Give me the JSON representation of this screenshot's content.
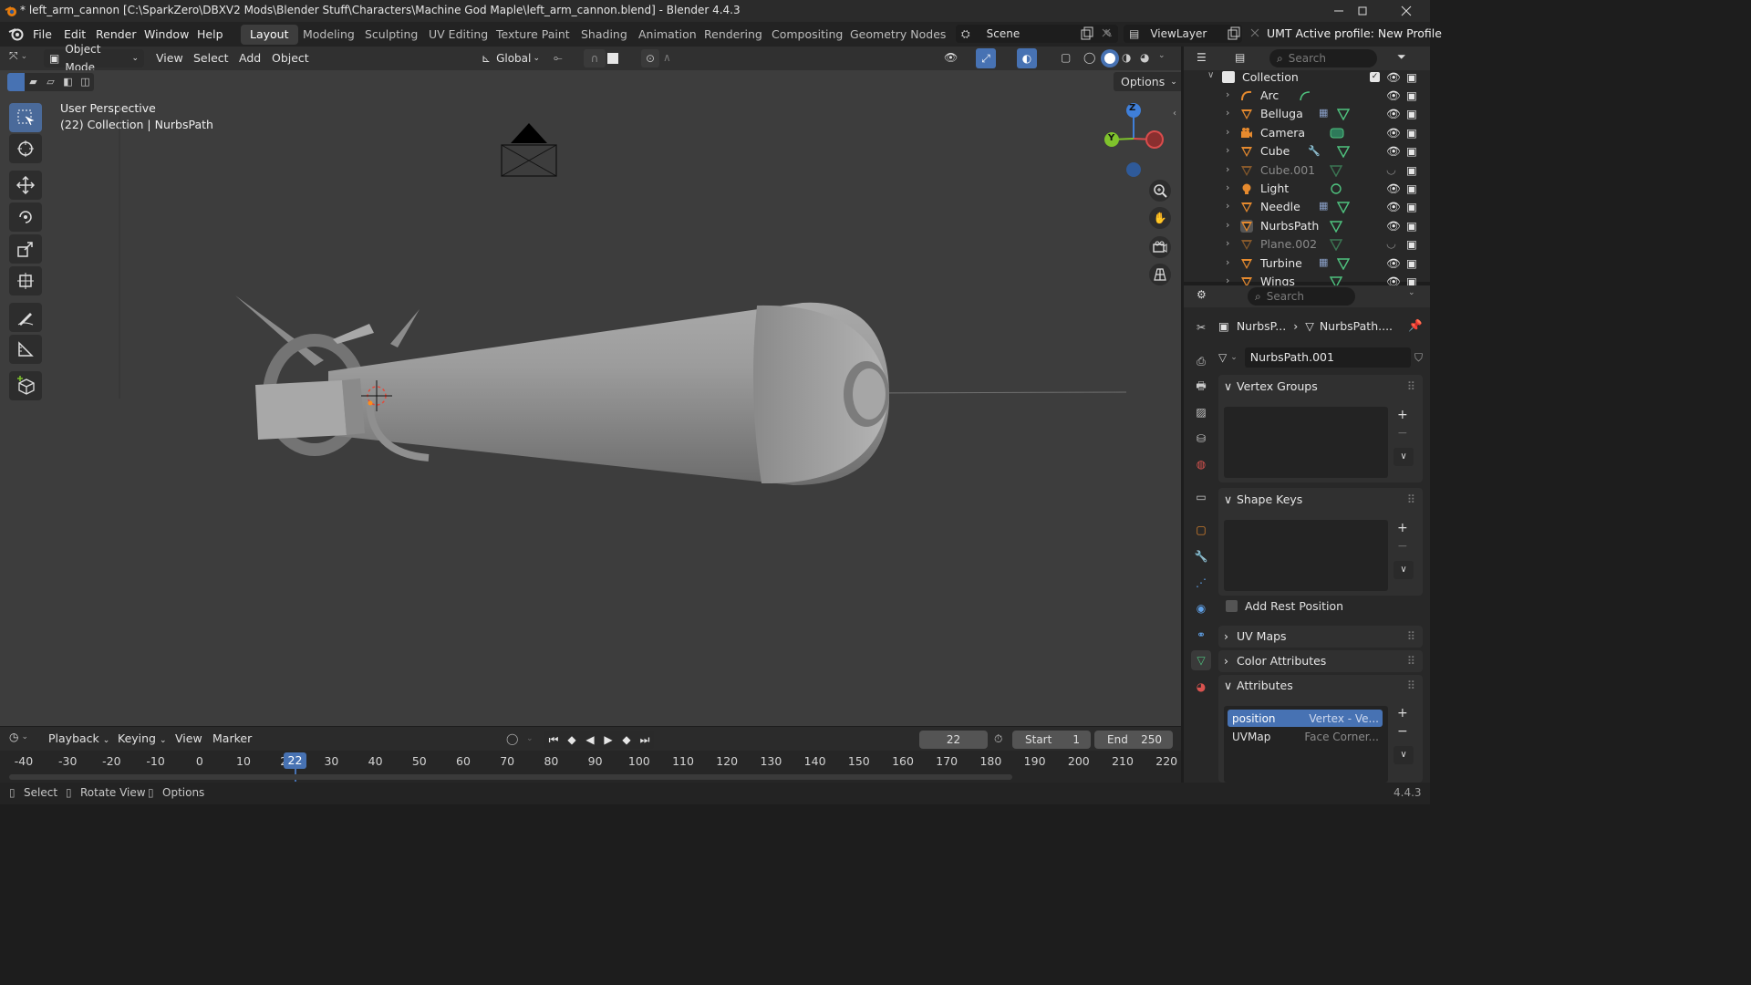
{
  "window": {
    "title": "* left_arm_cannon [C:\\SparkZero\\DBXV2 Mods\\Blender Stuff\\Characters\\Machine God Maple\\left_arm_cannon.blend] - Blender 4.4.3"
  },
  "menu": [
    "File",
    "Edit",
    "Render",
    "Window",
    "Help"
  ],
  "workspaces": [
    "Layout",
    "Modeling",
    "Sculpting",
    "UV Editing",
    "Texture Paint",
    "Shading",
    "Animation",
    "Rendering",
    "Compositing",
    "Geometry Nodes"
  ],
  "active_workspace": "Layout",
  "scene": {
    "name": "Scene",
    "view_layer": "ViewLayer",
    "profile_text": "UMT Active profile: New Profile"
  },
  "viewport_header": {
    "mode": "Object Mode",
    "menus": [
      "View",
      "Select",
      "Add",
      "Object"
    ],
    "orientation": "Global",
    "options_label": "Options"
  },
  "viewport": {
    "perspective": "User Perspective",
    "context": "(22) Collection | NurbsPath",
    "gizmo": {
      "z": "Z",
      "y": "Y"
    }
  },
  "outliner": {
    "search_placeholder": "Search",
    "collection": "Collection",
    "items": [
      {
        "name": "Arc",
        "type": "curve",
        "dim": false
      },
      {
        "name": "Belluga",
        "type": "mesh",
        "dim": false
      },
      {
        "name": "Camera",
        "type": "camera",
        "dim": false
      },
      {
        "name": "Cube",
        "type": "mesh",
        "dim": false
      },
      {
        "name": "Cube.001",
        "type": "mesh",
        "dim": true
      },
      {
        "name": "Light",
        "type": "light",
        "dim": false
      },
      {
        "name": "Needle",
        "type": "mesh",
        "dim": false
      },
      {
        "name": "NurbsPath",
        "type": "mesh",
        "dim": false
      },
      {
        "name": "Plane.002",
        "type": "mesh",
        "dim": true
      },
      {
        "name": "Turbine",
        "type": "mesh",
        "dim": false
      },
      {
        "name": "Wings",
        "type": "mesh",
        "dim": false
      }
    ]
  },
  "properties": {
    "search_placeholder": "Search",
    "breadcrumb_object": "NurbsP...",
    "breadcrumb_data": "NurbsPath....",
    "data_name": "NurbsPath.001",
    "panels": {
      "vertex_groups": "Vertex Groups",
      "shape_keys": "Shape Keys",
      "add_rest_position": "Add Rest Position",
      "uv_maps": "UV Maps",
      "color_attributes": "Color Attributes",
      "attributes": "Attributes"
    },
    "attributes": [
      {
        "name": "position",
        "domain": "Vertex - Ve...",
        "selected": true
      },
      {
        "name": "UVMap",
        "domain": "Face Corner...",
        "selected": false
      }
    ]
  },
  "timeline": {
    "menus": [
      "Playback",
      "Keying",
      "View",
      "Marker"
    ],
    "current_frame": "22",
    "start_label": "Start",
    "start": "1",
    "end_label": "End",
    "end": "250",
    "ticks": [
      "-40",
      "-30",
      "-20",
      "-10",
      "0",
      "10",
      "20",
      "30",
      "40",
      "50",
      "60",
      "70",
      "80",
      "90",
      "100",
      "110",
      "120",
      "130",
      "140",
      "150",
      "160",
      "170",
      "180",
      "190",
      "200",
      "210",
      "220"
    ]
  },
  "statusbar": {
    "hints": [
      "Select",
      "Rotate View",
      "Options"
    ],
    "version": "4.4.3"
  },
  "colors": {
    "accent": "#4772b3",
    "x_axis": "#d94c4c",
    "y_axis": "#7fc32c",
    "z_axis": "#3f7fd9",
    "header": "#303030",
    "viewport": "#3d3d3d"
  }
}
